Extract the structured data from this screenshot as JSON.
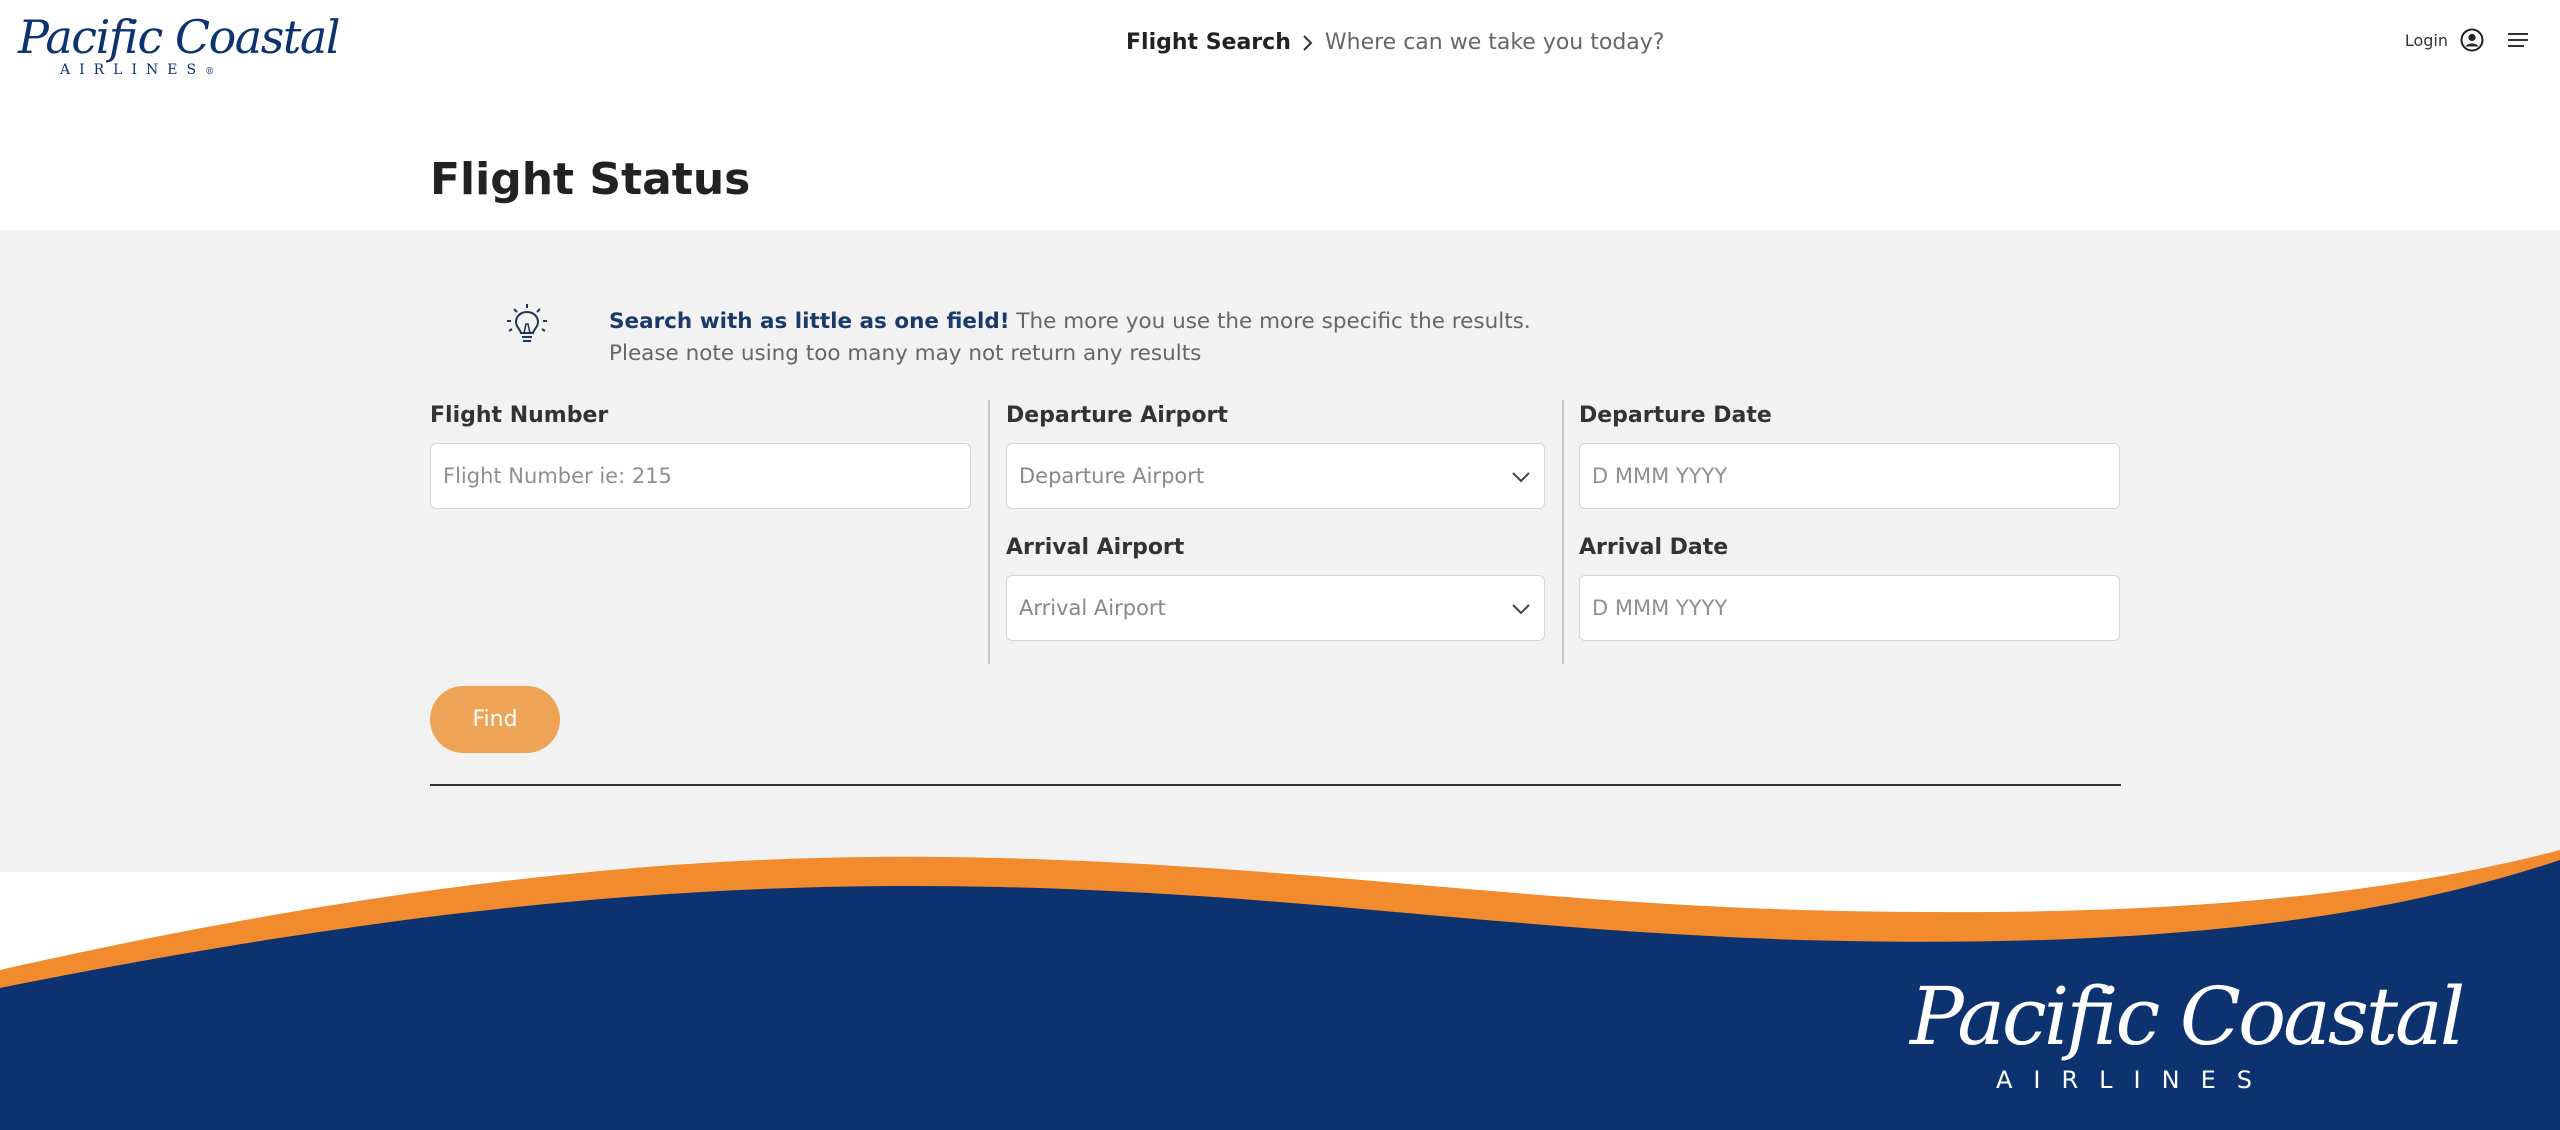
{
  "brand": {
    "name": "Pacific Coastal",
    "sub": "AIRLINES",
    "reg": "®",
    "navy": "#0c3370",
    "orange": "#f28a2e"
  },
  "header": {
    "breadcrumb_current": "Flight Search",
    "breadcrumb_prompt": "Where can we take you today?",
    "login_label": "Login",
    "user_icon": "user-circle-icon",
    "menu_icon": "hamburger-menu-icon"
  },
  "page": {
    "title": "Flight Status"
  },
  "tip": {
    "icon": "lightbulb-icon",
    "bold": "Search with as little as one field!",
    "line1_rest": " The more you use the more specific the results.",
    "line2": "Please note using too many may not return any results"
  },
  "form": {
    "flight_number": {
      "label": "Flight Number",
      "placeholder": "Flight Number ie: 215",
      "value": ""
    },
    "departure_airport": {
      "label": "Departure Airport",
      "selected": "Departure Airport"
    },
    "arrival_airport": {
      "label": "Arrival Airport",
      "selected": "Arrival Airport"
    },
    "departure_date": {
      "label": "Departure Date",
      "placeholder": "D MMM YYYY",
      "value": ""
    },
    "arrival_date": {
      "label": "Arrival Date",
      "placeholder": "D MMM YYYY",
      "value": ""
    },
    "find_label": "Find",
    "find_color": "#eea456"
  },
  "footer": {
    "name": "Pacific Coastal",
    "sub": "AIRLINES"
  }
}
